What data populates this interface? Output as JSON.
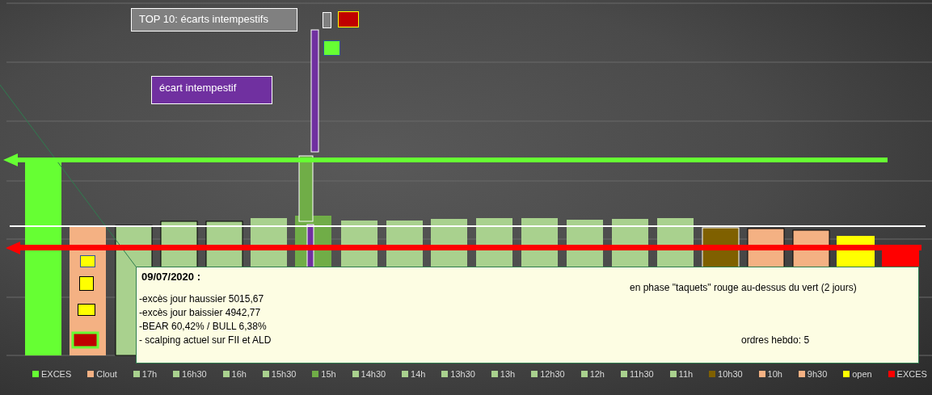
{
  "title_box": "TOP 10: écarts intempestifs",
  "label_box": "écart intempestif",
  "note": {
    "date": "09/07/2020 :",
    "phase": "en phase \"taquets\" rouge au-dessus du vert (2 jours)",
    "lines": [
      "-excès jour haussier 5015,67",
      "-excès jour baissier 4942,77",
      "-BEAR 60,42% / BULL 6,38%",
      "- scalping actuel sur FII et ALD"
    ],
    "orders": "ordres hebdo: 5"
  },
  "legend": [
    {
      "label": "EXCES",
      "color": "#66ff33"
    },
    {
      "label": "Clout",
      "color": "#f4b183"
    },
    {
      "label": "17h",
      "color": "#a9d18e"
    },
    {
      "label": "16h30",
      "color": "#a9d18e"
    },
    {
      "label": "16h",
      "color": "#a9d18e"
    },
    {
      "label": "15h30",
      "color": "#a9d18e"
    },
    {
      "label": "15h",
      "color": "#70ad47"
    },
    {
      "label": "14h30",
      "color": "#a9d18e"
    },
    {
      "label": "14h",
      "color": "#a9d18e"
    },
    {
      "label": "13h30",
      "color": "#a9d18e"
    },
    {
      "label": "13h",
      "color": "#a9d18e"
    },
    {
      "label": "12h30",
      "color": "#a9d18e"
    },
    {
      "label": "12h",
      "color": "#a9d18e"
    },
    {
      "label": "11h30",
      "color": "#a9d18e"
    },
    {
      "label": "11h",
      "color": "#a9d18e"
    },
    {
      "label": "10h30",
      "color": "#7f6000"
    },
    {
      "label": "10h",
      "color": "#f4b183"
    },
    {
      "label": "9h30",
      "color": "#f4b183"
    },
    {
      "label": "open",
      "color": "#ffff00"
    },
    {
      "label": "EXCES",
      "color": "#ff0000"
    }
  ]
}
